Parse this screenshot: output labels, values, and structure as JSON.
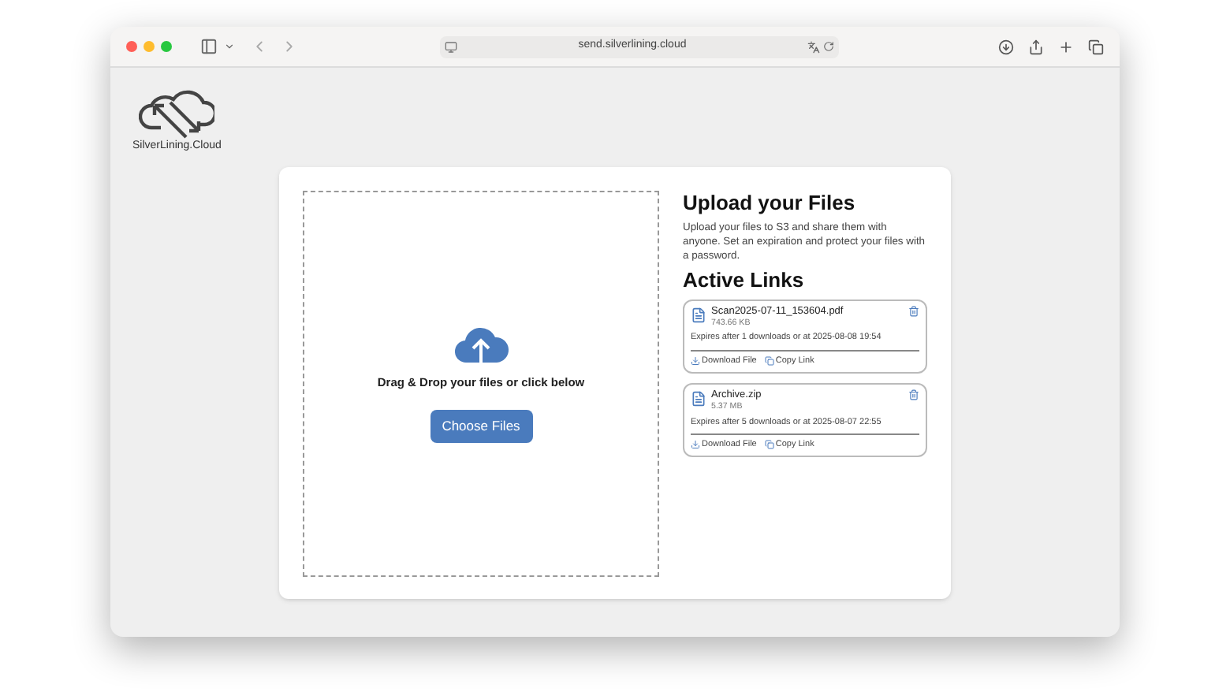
{
  "browser": {
    "url": "send.silverlining.cloud"
  },
  "logo": {
    "text": "SilverLining.Cloud"
  },
  "dropzone": {
    "prompt": "Drag & Drop your files or click below",
    "button": "Choose Files"
  },
  "intro": {
    "title": "Upload your Files",
    "text": "Upload your files to S3 and share them with anyone. Set an expiration and protect your files with a password."
  },
  "active_links": {
    "title": "Active Links",
    "items": [
      {
        "name": "Scan2025-07-11_153604.pdf",
        "size": "743.66 KB",
        "expiry": "Expires after 1 downloads or at 2025-08-08 19:54",
        "download": "Download File",
        "copy": "Copy Link"
      },
      {
        "name": "Archive.zip",
        "size": "5.37 MB",
        "expiry": "Expires after 5 downloads or at 2025-08-07 22:55",
        "download": "Download File",
        "copy": "Copy Link"
      }
    ]
  }
}
